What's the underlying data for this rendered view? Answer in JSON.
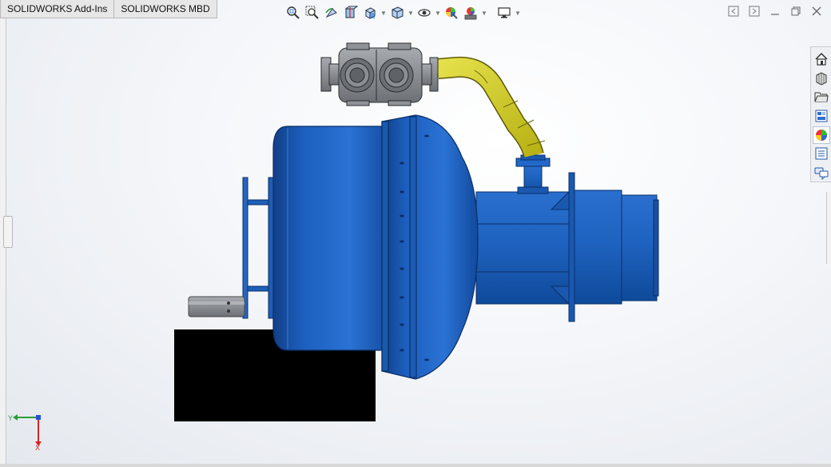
{
  "window": {
    "tabs": [
      {
        "label": "SOLIDWORKS Add-Ins"
      },
      {
        "label": "SOLIDWORKS MBD"
      }
    ]
  },
  "heads_up_toolbar": {
    "tools": [
      {
        "icon": "zoom-to-fit-icon"
      },
      {
        "icon": "zoom-to-area-icon"
      },
      {
        "icon": "previous-view-icon"
      },
      {
        "icon": "section-view-icon"
      },
      {
        "icon": "view-orientation-icon",
        "has_menu": true
      },
      {
        "icon": "display-style-icon",
        "has_menu": true
      },
      {
        "icon": "hide-show-items-icon",
        "has_menu": true
      },
      {
        "icon": "edit-appearance-icon"
      },
      {
        "icon": "apply-scene-icon",
        "has_menu": true
      },
      {
        "icon": "view-settings-icon",
        "has_menu": true
      }
    ]
  },
  "task_pane": {
    "items": [
      {
        "icon": "solidworks-resources-icon"
      },
      {
        "icon": "design-library-icon"
      },
      {
        "icon": "file-explorer-icon"
      },
      {
        "icon": "view-palette-icon"
      },
      {
        "icon": "appearances-scenes-icon",
        "active": true
      },
      {
        "icon": "custom-properties-icon"
      },
      {
        "icon": "solidworks-forum-icon"
      }
    ]
  },
  "triad": {
    "y_label": "Y",
    "x_label": "X",
    "colors": {
      "y": "#2e9b3a",
      "x": "#d42525",
      "z": "#2a4fd8"
    }
  },
  "model": {
    "colors": {
      "body_blue": "#1f63c0",
      "body_dark": "#0d3f87",
      "hose_yellow": "#d9d51d",
      "pump_gray": "#8d9196",
      "base_black": "#000000"
    }
  }
}
